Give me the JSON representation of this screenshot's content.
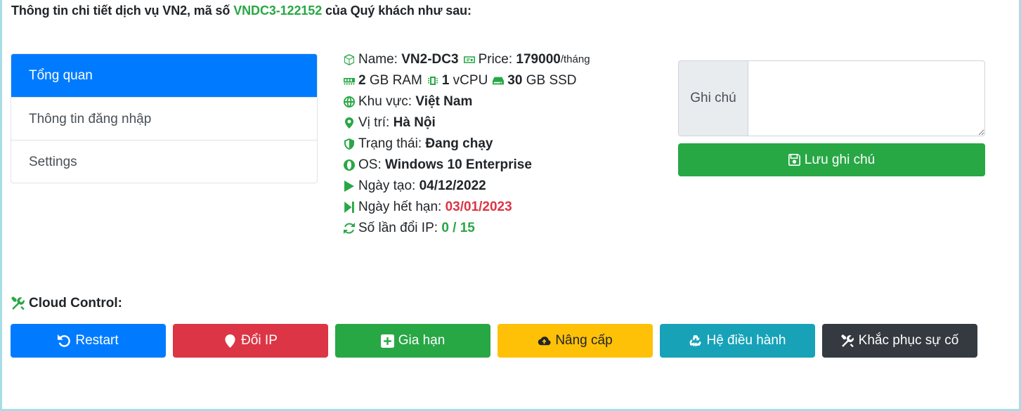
{
  "header": {
    "prefix": "Thông tin chi tiết dịch vụ VN2, mã số",
    "code": "VNDC3-122152",
    "suffix": "của Quý khách như sau:"
  },
  "tabs": [
    {
      "label": "Tổng quan",
      "active": true
    },
    {
      "label": "Thông tin đăng nhập",
      "active": false
    },
    {
      "label": "Settings",
      "active": false
    }
  ],
  "info": {
    "name_label": "Name:",
    "name_value": "VN2-DC3",
    "price_label": "Price:",
    "price_value": "179000",
    "price_unit": "/tháng",
    "ram_value": "2",
    "ram_unit": "GB RAM",
    "cpu_value": "1",
    "cpu_unit": "vCPU",
    "ssd_value": "30",
    "ssd_unit": "GB SSD",
    "region_label": "Khu vực:",
    "region_value": "Việt Nam",
    "location_label": "Vị trí:",
    "location_value": "Hà Nội",
    "status_label": "Trạng thái:",
    "status_value": "Đang chạy",
    "os_label": "OS:",
    "os_value": "Windows 10 Enterprise",
    "created_label": "Ngày tạo:",
    "created_value": "04/12/2022",
    "expire_label": "Ngày hết hạn:",
    "expire_value": "03/01/2023",
    "ipchange_label": "Số lần đổi IP:",
    "ipchange_value": "0 / 15"
  },
  "note": {
    "label": "Ghi chú",
    "value": "",
    "save_label": "Lưu ghi chú"
  },
  "cloud_control": {
    "title": "Cloud Control:",
    "buttons": [
      {
        "label": "Restart",
        "icon": "restart-icon",
        "color": "#007bff"
      },
      {
        "label": "Đổi IP",
        "icon": "map-marker-icon",
        "color": "#dc3545"
      },
      {
        "label": "Gia hạn",
        "icon": "plus-square-icon",
        "color": "#28a745"
      },
      {
        "label": "Nâng cấp",
        "icon": "cloud-upload-icon",
        "color": "#ffc107"
      },
      {
        "label": "Hệ điều hành",
        "icon": "recycle-icon",
        "color": "#17a2b8"
      },
      {
        "label": "Khắc phục sự cố",
        "icon": "tools-icon",
        "color": "#343a40"
      }
    ]
  },
  "colors": {
    "primary": "#007bff",
    "success": "#28a745",
    "danger": "#dc3545",
    "warning": "#ffc107",
    "info": "#17a2b8",
    "dark": "#343a40"
  }
}
